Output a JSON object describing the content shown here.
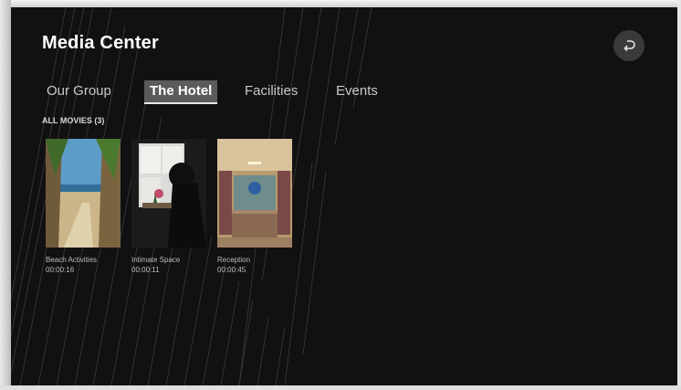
{
  "header": {
    "title": "Media Center",
    "back_icon": "return-arrow-icon"
  },
  "tabs": [
    {
      "label": "Our Group",
      "active": false
    },
    {
      "label": "The Hotel",
      "active": true
    },
    {
      "label": "Facilities",
      "active": false
    },
    {
      "label": "Events",
      "active": false
    }
  ],
  "section": {
    "label": "ALL MOVIES (3)"
  },
  "movies": [
    {
      "title": "Beach Activities",
      "duration": "00:00:16"
    },
    {
      "title": "Intimate Space",
      "duration": "00:00:11"
    },
    {
      "title": "Reception",
      "duration": "00:00:45"
    }
  ],
  "colors": {
    "background": "#111112",
    "active_tab": "#5b5b5c",
    "text": "#ffffff"
  }
}
